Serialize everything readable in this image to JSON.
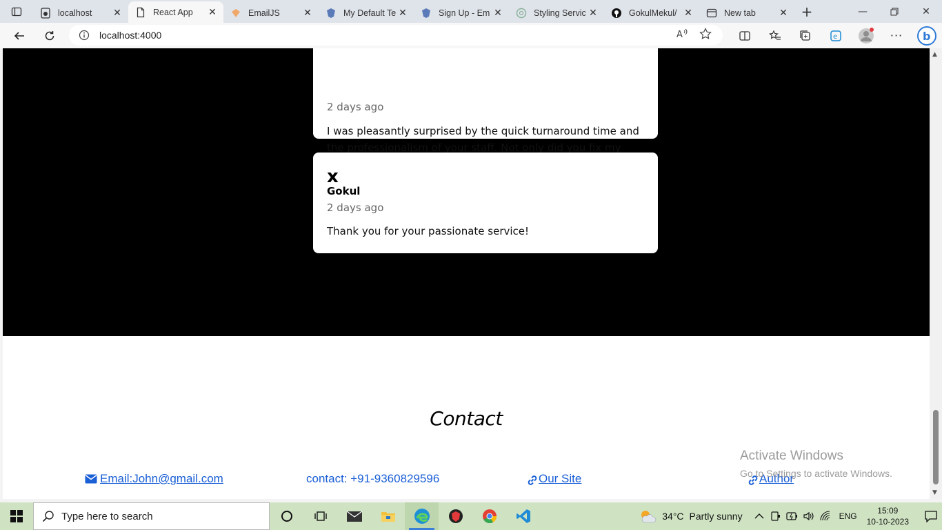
{
  "browser": {
    "tabs": [
      {
        "title": "localhost",
        "icon": "github-like-icon",
        "active": false
      },
      {
        "title": "React App",
        "icon": "page-icon",
        "active": true
      },
      {
        "title": "EmailJS",
        "icon": "emailjs-icon",
        "active": false
      },
      {
        "title": "My Default Te",
        "icon": "emailjs-shield-icon",
        "active": false
      },
      {
        "title": "Sign Up - Em",
        "icon": "emailjs-shield-icon",
        "active": false
      },
      {
        "title": "Styling Servic",
        "icon": "chatgpt-icon",
        "active": false
      },
      {
        "title": "GokulMekul/",
        "icon": "github-icon",
        "active": false
      },
      {
        "title": "New tab",
        "icon": "newtab-icon",
        "active": false
      }
    ],
    "url": "localhost:4000"
  },
  "reviews": [
    {
      "name": "",
      "date": "2 days ago",
      "text": "I was pleasantly surprised by the quick turnaround time and the professionalism of your staff. Not only did you fix my bike, but you also provided excellent customer service."
    },
    {
      "avatar": "x",
      "name": "Gokul",
      "date": "2 days ago",
      "text": "Thank you for your passionate service!"
    }
  ],
  "contact": {
    "title": "Contact",
    "email_label": "Email:John@gmail.com",
    "phone_label": "contact: +91-9360829596",
    "site_label": "Our Site",
    "author_label": "Author"
  },
  "watermark": {
    "line1": "Activate Windows",
    "line2": "Go to Settings to activate Windows."
  },
  "taskbar": {
    "search_placeholder": "Type here to search",
    "weather_temp": "34°C",
    "weather_desc": "Partly sunny",
    "lang": "ENG",
    "time": "15:09",
    "date": "10-10-2023"
  }
}
